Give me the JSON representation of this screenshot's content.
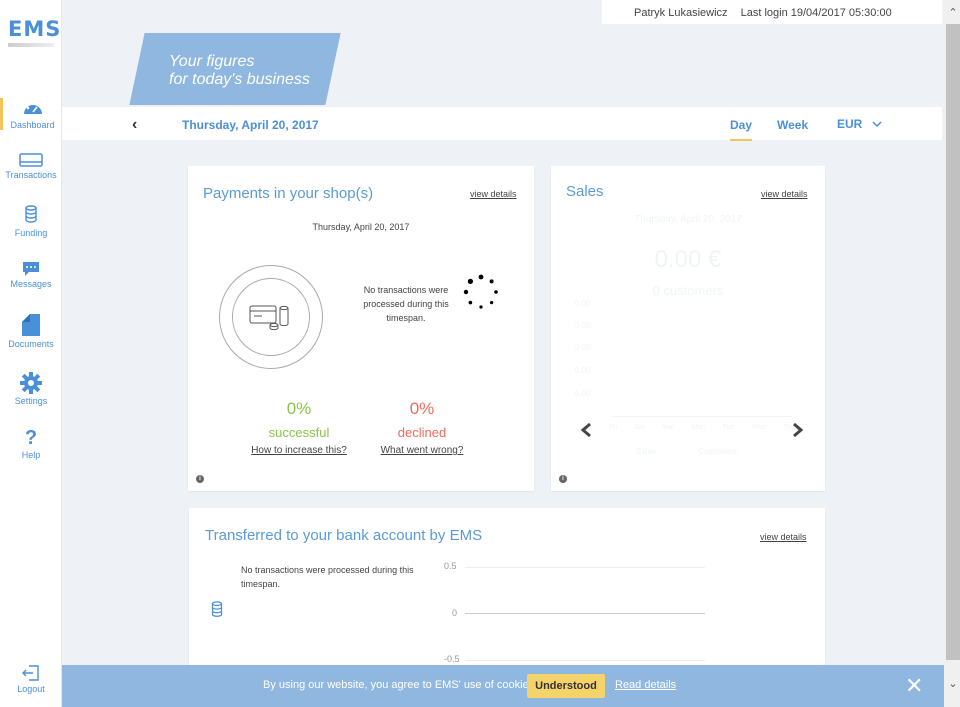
{
  "app": {
    "logo": "EMS"
  },
  "sidebar": {
    "items": [
      {
        "label": "Dashboard",
        "icon": "dashboard-gauge-icon"
      },
      {
        "label": "Transactions",
        "icon": "card-icon"
      },
      {
        "label": "Funding",
        "icon": "coins-icon"
      },
      {
        "label": "Messages",
        "icon": "message-icon"
      },
      {
        "label": "Documents",
        "icon": "document-icon"
      },
      {
        "label": "Settings",
        "icon": "gear-icon"
      },
      {
        "label": "Help",
        "icon": "help-icon"
      }
    ],
    "logout": "Logout"
  },
  "topbar": {
    "user": "Patryk Lukasiewicz",
    "last_login": "Last login 19/04/2017 05:30:00"
  },
  "banner": {
    "line1": "Your figures",
    "line2": "for today's business"
  },
  "datebar": {
    "date": "Thursday, April 20, 2017",
    "tab_day": "Day",
    "tab_week": "Week",
    "currency": "EUR"
  },
  "payments": {
    "title": "Payments in your shop(s)",
    "view_details": "view details",
    "date": "Thursday, April 20, 2017",
    "no_tx": "No transactions were processed during this timespan.",
    "success_pct": "0%",
    "success_label": "successful",
    "success_link": "How to increase this?",
    "declined_pct": "0%",
    "declined_label": "declined",
    "declined_link": "What went wrong?"
  },
  "sales": {
    "title": "Sales",
    "view_details": "view details",
    "faint_date": "Thursday, April 20, 2017",
    "faint_amount": "0.00 €",
    "faint_customers": "0 customers",
    "y_ticks": [
      "0.00",
      "0.00",
      "0.00",
      "0.00",
      "0.00"
    ],
    "x_ticks": [
      "Fri",
      "Sat",
      "Sun",
      "Mon",
      "Tue",
      "Wed",
      "Thu"
    ],
    "legend": [
      "Sales",
      "Customers"
    ]
  },
  "transfer": {
    "title": "Transferred to your bank account by EMS",
    "view_details": "view details",
    "no_tx": "No transactions were processed during this timespan.",
    "y_ticks": [
      "0.5",
      "0",
      "-0.5"
    ]
  },
  "cookie": {
    "text": "By using our website, you agree to EMS' use of cookies.",
    "button": "Understood",
    "link": "Read details"
  },
  "colors": {
    "accent": "#4a90d9",
    "success": "#8bc34a",
    "declined": "#f06a5a",
    "highlight": "#f5c35b"
  }
}
